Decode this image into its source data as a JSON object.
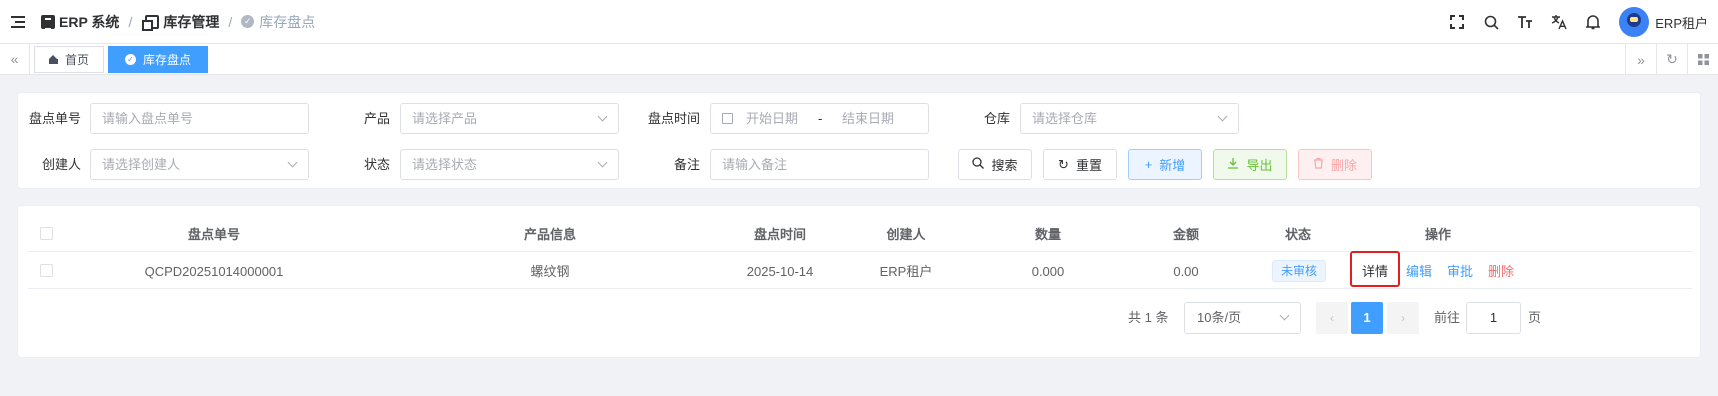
{
  "header": {
    "breadcrumb": [
      {
        "label": "ERP 系统"
      },
      {
        "label": "库存管理"
      },
      {
        "label": "库存盘点"
      }
    ],
    "separator": "/",
    "username": "ERP租户",
    "icons": [
      "fullscreen-icon",
      "search-icon",
      "font-size-icon",
      "translate-icon",
      "bell-icon"
    ]
  },
  "tabs": {
    "items": [
      {
        "label": "首页",
        "active": false
      },
      {
        "label": "库存盘点",
        "active": true
      }
    ]
  },
  "filters": {
    "row1": [
      {
        "label": "盘点单号",
        "placeholder": "请输入盘点单号"
      },
      {
        "label": "产品",
        "placeholder": "请选择产品"
      },
      {
        "label": "盘点时间",
        "start_placeholder": "开始日期",
        "range_sep": "-",
        "end_placeholder": "结束日期"
      },
      {
        "label": "仓库",
        "placeholder": "请选择仓库"
      }
    ],
    "row2": [
      {
        "label": "创建人",
        "placeholder": "请选择创建人"
      },
      {
        "label": "状态",
        "placeholder": "请选择状态"
      },
      {
        "label": "备注",
        "placeholder": "请输入备注"
      }
    ],
    "buttons": {
      "search": "搜索",
      "reset": "重置",
      "add": "新增",
      "export": "导出",
      "delete": "删除"
    }
  },
  "table": {
    "columns": [
      "盘点单号",
      "产品信息",
      "盘点时间",
      "创建人",
      "数量",
      "金额",
      "状态",
      "操作"
    ],
    "rows": [
      {
        "no": "QCPD20251014000001",
        "product": "螺纹钢",
        "time": "2025-10-14",
        "creator": "ERP租户",
        "quantity": "0.000",
        "amount": "0.00",
        "status": "未审核",
        "actions": {
          "detail": "详情",
          "edit": "编辑",
          "approve": "审批",
          "delete": "删除"
        }
      }
    ]
  },
  "pagination": {
    "total_text": "共 1 条",
    "page_size": "10条/页",
    "current_page": "1",
    "goto_prefix": "前往",
    "goto_value": "1",
    "goto_suffix": "页"
  },
  "colors": {
    "primary": "#409eff",
    "success": "#67c23a",
    "danger": "#f56c6c",
    "highlight": "#e02020"
  }
}
